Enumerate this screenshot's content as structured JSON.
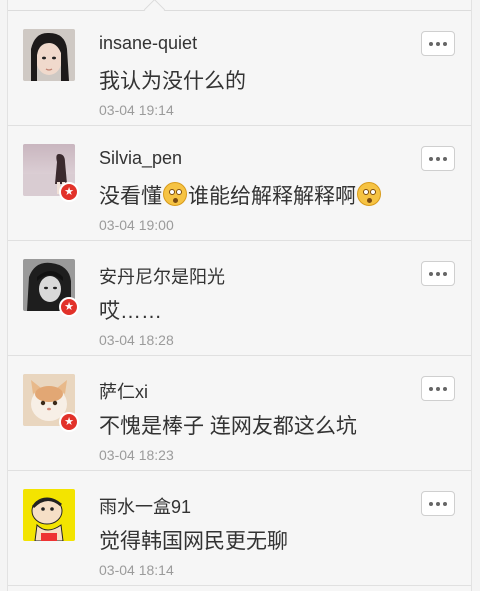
{
  "comments": [
    {
      "username": "insane-quiet",
      "text": "我认为没什么的",
      "time": "03-04 19:14",
      "verified": false
    },
    {
      "username": "Silvia_pen",
      "text_parts": [
        "没看懂",
        "谁能给解释解释啊"
      ],
      "emojis": [
        "confused-face",
        "flushed-face"
      ],
      "time": "03-04 19:00",
      "verified": true
    },
    {
      "username": "安丹尼尔是阳光",
      "text": "哎……",
      "time": "03-04 18:28",
      "verified": true
    },
    {
      "username": "萨仁xi",
      "text": "不愧是棒子 连网友都这么坑",
      "time": "03-04 18:23",
      "verified": true
    },
    {
      "username": "雨水一盒91",
      "text": "觉得韩国网民更无聊",
      "time": "03-04 18:14",
      "verified": false
    }
  ],
  "colors": {
    "verified_badge": "#e2322a",
    "name_text": "#333333",
    "time_text": "#9b9b9b"
  },
  "icons": {
    "more": "more-options-icon",
    "verified": "verified-star-icon"
  }
}
